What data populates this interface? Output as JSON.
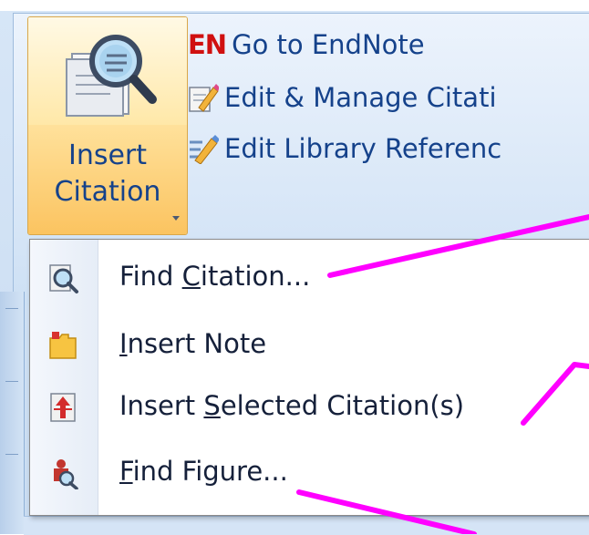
{
  "ribbon": {
    "insert_citation": {
      "line1": "Insert",
      "line2": "Citation",
      "icon": "magnifier-document-icon"
    },
    "commands": [
      {
        "badge": "EN",
        "label": "Go to EndNote",
        "icon": "endnote-badge"
      },
      {
        "label": "Edit & Manage Citati",
        "icon": "edit-citation-pencil-icon"
      },
      {
        "label": "Edit Library Referenc",
        "icon": "edit-library-pencil-icon"
      }
    ]
  },
  "menu": {
    "items": [
      {
        "pre": "Find ",
        "accel": "C",
        "post": "itation...",
        "icon": "find-citation-icon"
      },
      {
        "pre": "",
        "accel": "I",
        "post": "nsert Note",
        "icon": "folder-note-icon"
      },
      {
        "pre": "Insert ",
        "accel": "S",
        "post": "elected Citation(s)",
        "icon": "insert-selected-icon"
      },
      {
        "pre": "",
        "accel": "F",
        "post": "ind Figure...",
        "icon": "find-figure-icon"
      }
    ]
  },
  "colors": {
    "accent_text": "#15428b",
    "button_hover": "#ffe19b",
    "annotation": "#ff00ff",
    "en_badge": "#d01010"
  }
}
